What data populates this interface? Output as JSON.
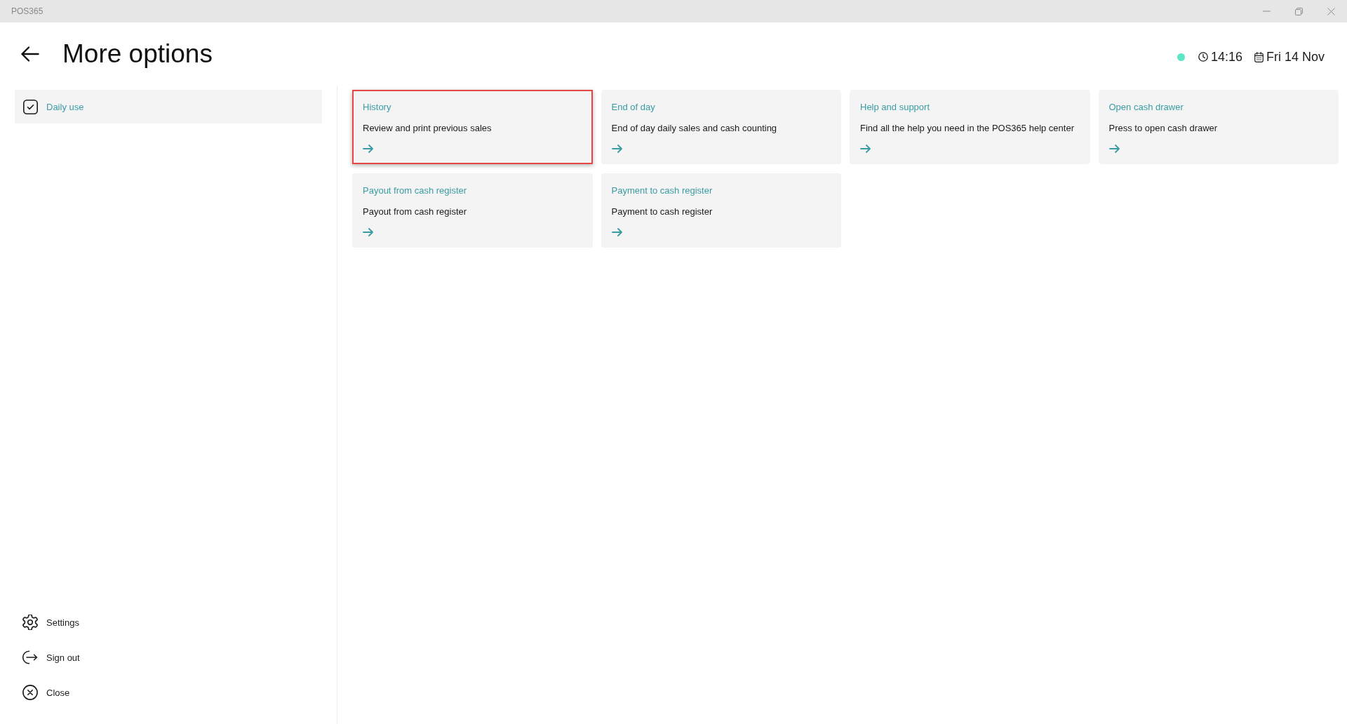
{
  "window": {
    "title": "POS365"
  },
  "header": {
    "title": "More options"
  },
  "status": {
    "online": true,
    "time": "14:16",
    "date": "Fri 14 Nov"
  },
  "sidebar": {
    "categories": [
      {
        "label": "Daily use",
        "selected": true
      }
    ],
    "footer_items": [
      {
        "kind": "settings",
        "label": "Settings"
      },
      {
        "kind": "sign_out",
        "label": "Sign out"
      },
      {
        "kind": "close",
        "label": "Close"
      }
    ]
  },
  "options": [
    {
      "title": "History",
      "description": "Review and print previous sales",
      "selected": true
    },
    {
      "title": "End of day",
      "description": "End of day daily sales and cash counting",
      "selected": false
    },
    {
      "title": "Help and support",
      "description": "Find all the help you need in the POS365 help center",
      "selected": false
    },
    {
      "title": "Open cash drawer",
      "description": "Press to open cash drawer",
      "selected": false
    },
    {
      "title": "Payout from cash register",
      "description": "Payout from cash register",
      "selected": false
    },
    {
      "title": "Payment to cash register",
      "description": "Payment to cash register",
      "selected": false
    }
  ]
}
